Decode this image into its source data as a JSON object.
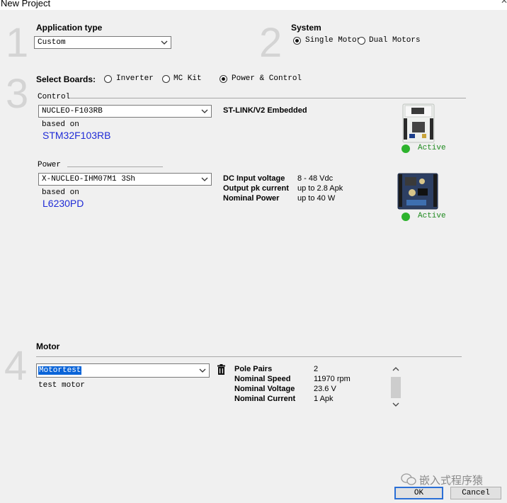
{
  "window": {
    "title": "New Project"
  },
  "step1": {
    "number": "1",
    "heading": "Application type",
    "value": "Custom"
  },
  "step2": {
    "number": "2",
    "heading": "System",
    "options": [
      "Single Motor",
      "Dual Motors"
    ],
    "selected": "Single Motor"
  },
  "step3": {
    "number": "3",
    "heading": "Select Boards:",
    "options": [
      "Inverter",
      "MC Kit",
      "Power & Control"
    ],
    "selected": "Power & Control",
    "control": {
      "label": "Control",
      "value": "NUCLEO-F103RB",
      "based_on_label": "based on",
      "based_on": "STM32F103RB",
      "info": "ST-LINK/V2 Embedded",
      "status": "Active"
    },
    "power": {
      "label": "Power",
      "value": "X-NUCLEO-IHM07M1 3Sh",
      "based_on_label": "based on",
      "based_on": "L6230PD",
      "specs": [
        {
          "label": "DC Input voltage",
          "value": "8 - 48 Vdc"
        },
        {
          "label": "Output pk current",
          "value": "up to 2.8 Apk"
        },
        {
          "label": "Nominal Power",
          "value": "up to 40 W"
        }
      ],
      "status": "Active"
    }
  },
  "step4": {
    "number": "4",
    "heading": "Motor",
    "value": "Motortest",
    "description": "test motor",
    "specs": [
      {
        "label": "Pole Pairs",
        "value": "2"
      },
      {
        "label": "Nominal Speed",
        "value": "11970 rpm"
      },
      {
        "label": "Nominal Voltage",
        "value": "23.6 V"
      },
      {
        "label": "Nominal Current",
        "value": "1 Apk"
      }
    ]
  },
  "watermark": "嵌入式程序猿",
  "buttons": {
    "ok": "OK",
    "cancel": "Cancel"
  },
  "colors": {
    "status_green": "#2db32d",
    "link_blue": "#1f2bd6",
    "selection": "#0a64d8"
  }
}
